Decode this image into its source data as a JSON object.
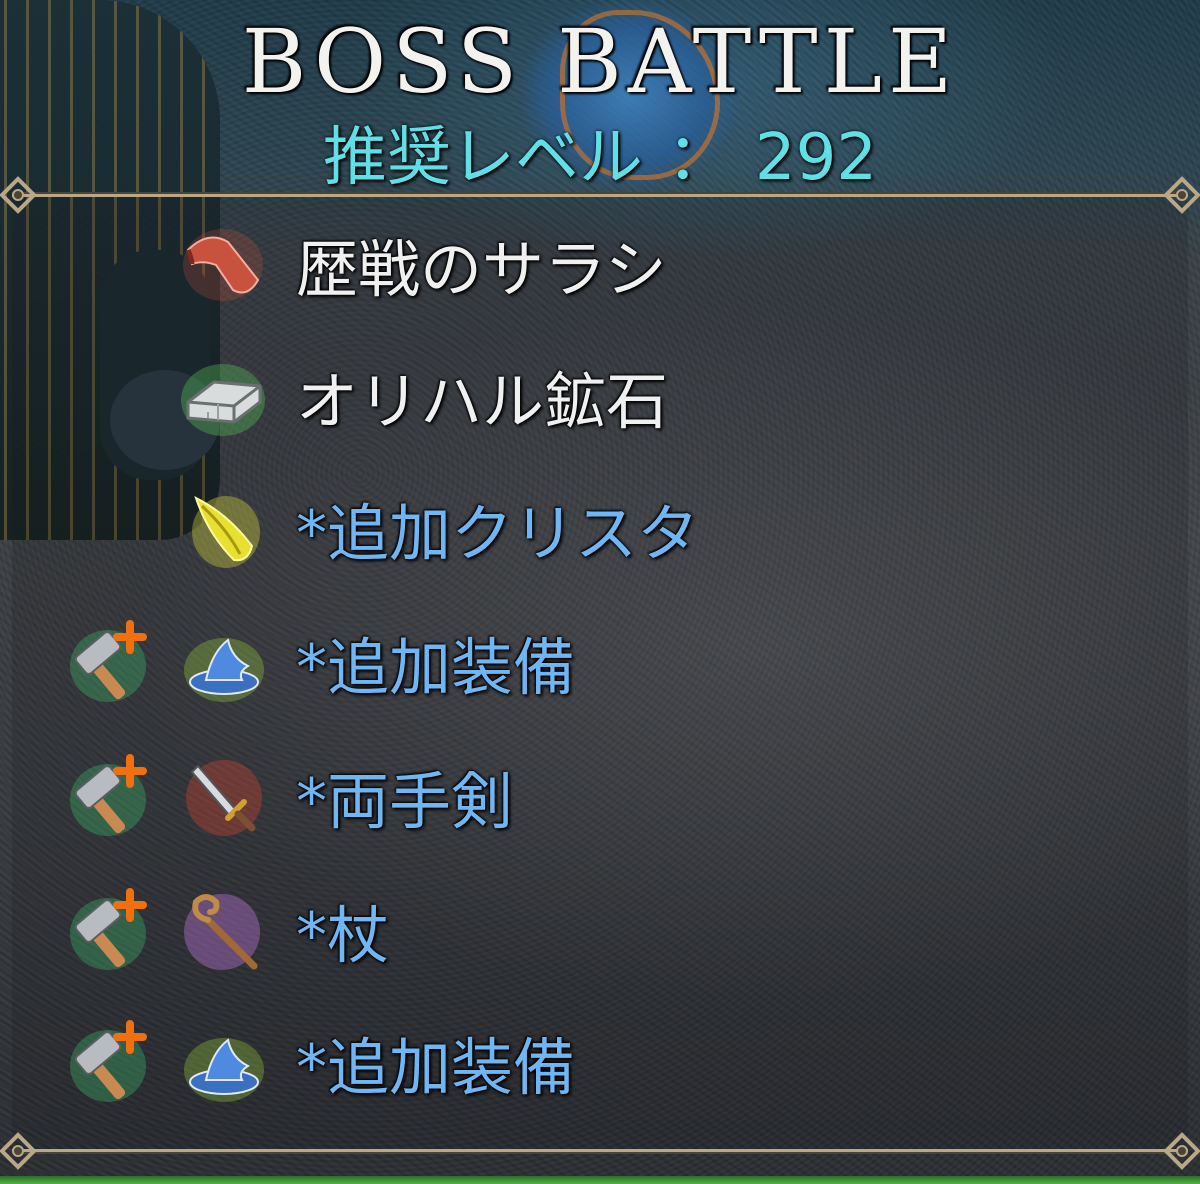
{
  "header": {
    "title": "BOSS BATTLE",
    "recommended_level_label": "推奨レベル",
    "separator": "：",
    "recommended_level_value": "292"
  },
  "rewards": [
    {
      "label": "歴戦のサラシ",
      "icon": "cloth-sarashi-icon",
      "bonus": false,
      "craft_bonus_icon": null
    },
    {
      "label": "オリハル鉱石",
      "icon": "ore-ingot-icon",
      "bonus": false,
      "craft_bonus_icon": null
    },
    {
      "label": "*追加クリスタ",
      "icon": "yellow-crystal-icon",
      "bonus": true,
      "craft_bonus_icon": null
    },
    {
      "label": "*追加装備",
      "icon": "wizard-hat-icon",
      "bonus": true,
      "craft_bonus_icon": "hammer-plus-icon"
    },
    {
      "label": "*両手剣",
      "icon": "two-handed-sword-icon",
      "bonus": true,
      "craft_bonus_icon": "hammer-plus-icon"
    },
    {
      "label": "*杖",
      "icon": "staff-icon",
      "bonus": true,
      "craft_bonus_icon": "hammer-plus-icon"
    },
    {
      "label": "*追加装備",
      "icon": "wizard-hat-icon",
      "bonus": true,
      "craft_bonus_icon": "hammer-plus-icon"
    }
  ],
  "colors": {
    "title": "#f2f2ee",
    "level": "#5fe0e6",
    "normal_item_text": "#f0f0f0",
    "bonus_item_text": "#6fb6f4",
    "frame": "#b8a888"
  }
}
